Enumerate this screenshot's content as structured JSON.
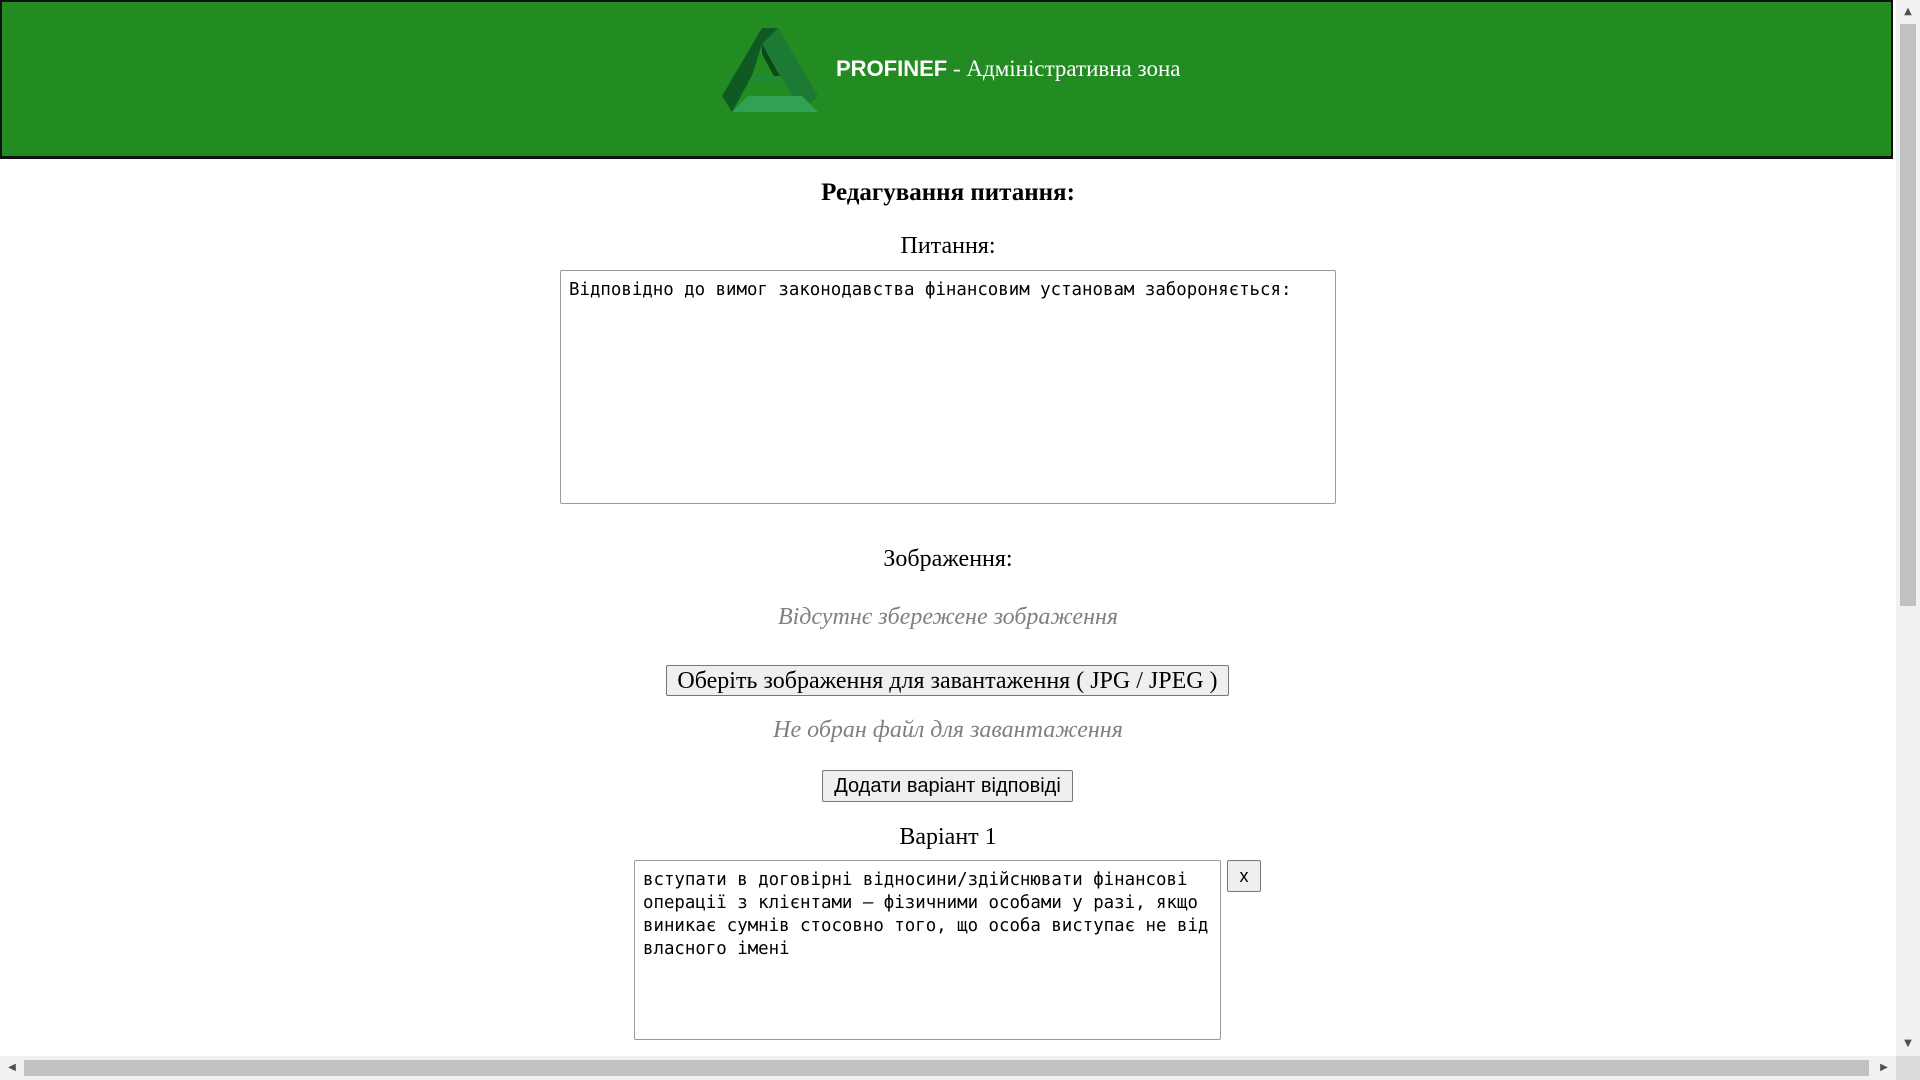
{
  "header": {
    "brand_name": "PROFINEF",
    "separator": " - ",
    "zone_title": "Адміністративна зона",
    "background_color": "#228b22",
    "logo_icon": "impossible-triangle-logo"
  },
  "page": {
    "heading": "Редагування питання:"
  },
  "question": {
    "label": "Питання:",
    "value": "Відповідно до вимог законодавства фінансовим установам забороняється:"
  },
  "image": {
    "label": "Зображення:",
    "no_saved_image_text": "Відсутнє збережене зображення",
    "choose_button_label": "Оберіть зображення для завантаження ( JPG / JPEG )",
    "no_file_selected_text": "Не обран файл для завантаження"
  },
  "add_variant_button_label": "Додати варіант відповіді",
  "variants": [
    {
      "label": "Варіант 1",
      "value": "вступати в договірні відносини/здійснювати фінансові операції з клієнтами – фізичними особами у разі, якщо виникає сумнів стосовно того, що особа виступає не від власного імені",
      "remove_button_label": "x"
    }
  ],
  "scrollbars": {
    "up_arrow": "▲",
    "down_arrow": "▼",
    "left_arrow": "◀",
    "right_arrow": "▶"
  }
}
